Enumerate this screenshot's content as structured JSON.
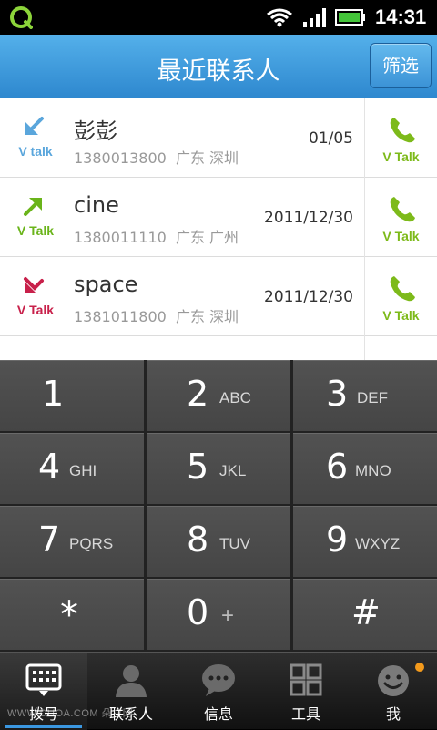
{
  "status_bar": {
    "time": "14:31"
  },
  "header": {
    "title": "最近联系人",
    "filter_label": "筛选"
  },
  "calls": [
    {
      "type": "incoming",
      "type_label": "V talk",
      "type_color": "#5aa6dc",
      "name": "彭彭",
      "number": "1380013800",
      "location": "广东 深圳",
      "date": "01/05",
      "dial_label": "V Talk"
    },
    {
      "type": "outgoing",
      "type_label": "V Talk",
      "type_color": "#6ab41a",
      "name": "cine",
      "number": "1380011110",
      "location": "广东 广州",
      "date": "2011/12/30",
      "dial_label": "V Talk"
    },
    {
      "type": "missed",
      "type_label": "V Talk",
      "type_color": "#c8204a",
      "name": "space",
      "number": "1381011800",
      "location": "广东 深圳",
      "date": "2011/12/30",
      "dial_label": "V Talk"
    }
  ],
  "dial_pad": {
    "keys": [
      {
        "digit": "1",
        "letters": ""
      },
      {
        "digit": "2",
        "letters": "ABC"
      },
      {
        "digit": "3",
        "letters": "DEF"
      },
      {
        "digit": "4",
        "letters": "GHI"
      },
      {
        "digit": "5",
        "letters": "JKL"
      },
      {
        "digit": "6",
        "letters": "MNO"
      },
      {
        "digit": "7",
        "letters": "PQRS"
      },
      {
        "digit": "8",
        "letters": "TUV"
      },
      {
        "digit": "9",
        "letters": "WXYZ"
      },
      {
        "digit": "*",
        "letters": ""
      },
      {
        "digit": "0",
        "letters": "+"
      },
      {
        "digit": "#",
        "letters": ""
      }
    ]
  },
  "tabs": [
    {
      "label": "拨号",
      "icon": "dialpad-icon",
      "active": true
    },
    {
      "label": "联系人",
      "icon": "contact-icon",
      "active": false
    },
    {
      "label": "信息",
      "icon": "message-icon",
      "active": false
    },
    {
      "label": "工具",
      "icon": "grid-icon",
      "active": false
    },
    {
      "label": "我",
      "icon": "smiley-icon",
      "active": false
    }
  ],
  "watermark": "WWW.DUOA.COM 朵拉网",
  "colors": {
    "accent": "#3b97e0",
    "vtalk_green": "#7dba1a",
    "notify": "#f39a1c"
  }
}
